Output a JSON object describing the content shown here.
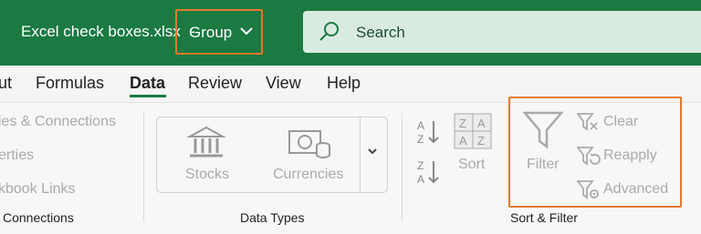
{
  "titlebar": {
    "filename": "Excel check boxes.xlsx",
    "separator": "-",
    "group_label": "Group",
    "search_placeholder": "Search"
  },
  "tabs": [
    {
      "label": "ut"
    },
    {
      "label": "Formulas"
    },
    {
      "label": "Data"
    },
    {
      "label": "Review"
    },
    {
      "label": "View"
    },
    {
      "label": "Help"
    }
  ],
  "active_tab": "Data",
  "ribbon": {
    "queries_group": {
      "items": [
        "ies & Connections",
        "erties",
        "kbook Links"
      ],
      "label": "Connections"
    },
    "data_types_group": {
      "stocks": "Stocks",
      "currencies": "Currencies",
      "label": "Data Types"
    },
    "sort_filter_group": {
      "sort": "Sort",
      "filter": "Filter",
      "clear": "Clear",
      "reapply": "Reapply",
      "advanced": "Advanced",
      "label": "Sort & Filter"
    }
  },
  "colors": {
    "titlebar_green": "#1a7a42",
    "highlight_orange": "#e5772a",
    "disabled_gray": "#aaaaaa"
  }
}
